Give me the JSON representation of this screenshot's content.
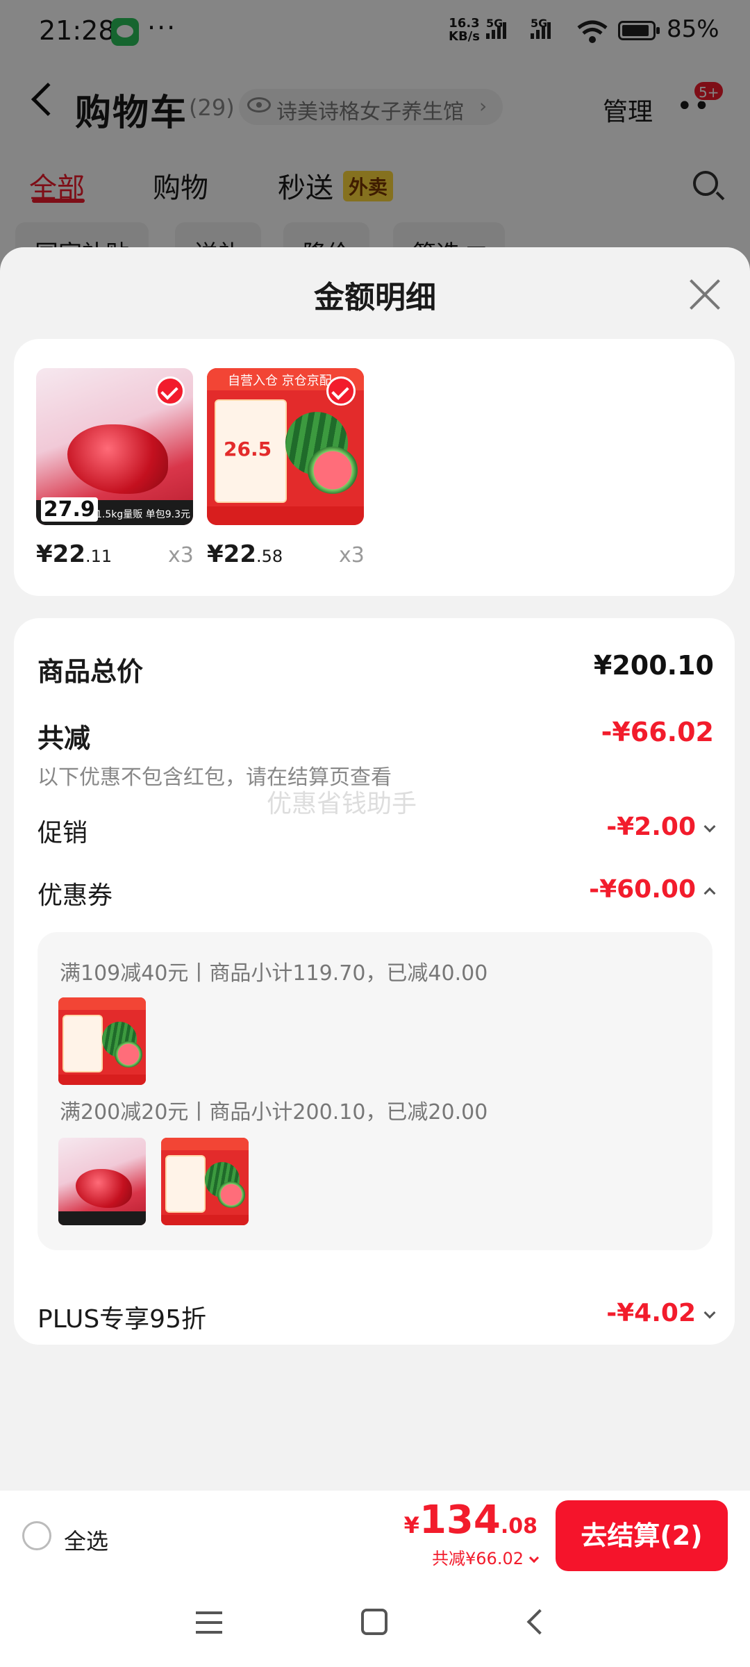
{
  "status_bar": {
    "time": "21:28",
    "dots": "···",
    "speed_value": "16.3",
    "speed_unit": "KB/s",
    "sig1": "5G",
    "sig2": "5G",
    "battery": "85%"
  },
  "header": {
    "title": "购物车",
    "count": "(29)",
    "store": "诗美诗格女子养生馆",
    "manage": "管理",
    "badge": "5+"
  },
  "tabs": [
    {
      "label": "全部"
    },
    {
      "label": "购物"
    },
    {
      "label": "秒送"
    }
  ],
  "tab_badge": "外卖",
  "filters": [
    "国家补贴",
    "送礼",
    "降价",
    "筛选 ▽"
  ],
  "sheet": {
    "title": "金额明细",
    "products": [
      {
        "price_int": "¥22",
        "price_dec": ".11",
        "qty": "x3",
        "img_price": "27.9",
        "img_caption": "1.5kg量贩 单包9.3元"
      },
      {
        "price_int": "¥22",
        "price_dec": ".58",
        "qty": "x3",
        "img_price": "26.5",
        "img_caption": "自营入仓 京仓京配"
      }
    ],
    "total_label": "商品总价",
    "total_value": "¥200.10",
    "reduce_label": "共减",
    "reduce_value": "-¥66.02",
    "reduce_note": "以下优惠不包含红包，请在结算页查看",
    "watermark": "优惠省钱助手",
    "promo_label": "促销",
    "promo_value": "-¥2.00",
    "coupon_label": "优惠券",
    "coupon_value": "-¥60.00",
    "coupon_rules": [
      "满109减40元丨商品小计119.70，已减40.00",
      "满200减20元丨商品小计200.10，已减20.00"
    ],
    "plus_label": "PLUS专享95折",
    "plus_value": "-¥4.02"
  },
  "footer": {
    "select_all": "全选",
    "currency": "¥",
    "total_int": "134",
    "total_dec": ".08",
    "discount": "共减¥66.02",
    "checkout": "去结算(2)"
  }
}
